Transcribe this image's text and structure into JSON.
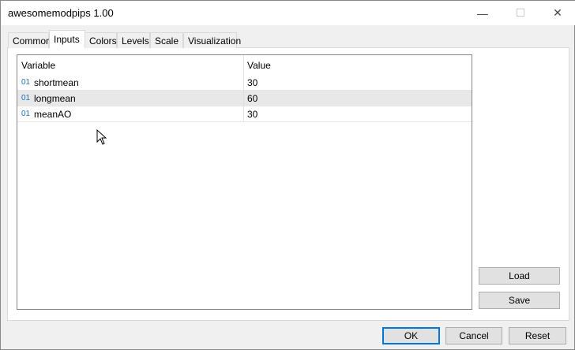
{
  "window": {
    "title": "awesomemodpips 1.00",
    "minimize": "—",
    "maximize": "☐",
    "close": "✕"
  },
  "tabs": [
    {
      "label": "Common"
    },
    {
      "label": "Inputs"
    },
    {
      "label": "Colors"
    },
    {
      "label": "Levels"
    },
    {
      "label": "Scale"
    },
    {
      "label": "Visualization"
    }
  ],
  "active_tab": "Inputs",
  "table": {
    "headers": {
      "variable": "Variable",
      "value": "Value"
    },
    "rows": [
      {
        "icon": "01",
        "variable": "shortmean",
        "value": "30"
      },
      {
        "icon": "01",
        "variable": "longmean",
        "value": "60"
      },
      {
        "icon": "01",
        "variable": "meanAO",
        "value": "30"
      }
    ]
  },
  "side_buttons": {
    "load": "Load",
    "save": "Save"
  },
  "footer": {
    "ok": "OK",
    "cancel": "Cancel",
    "reset": "Reset"
  }
}
